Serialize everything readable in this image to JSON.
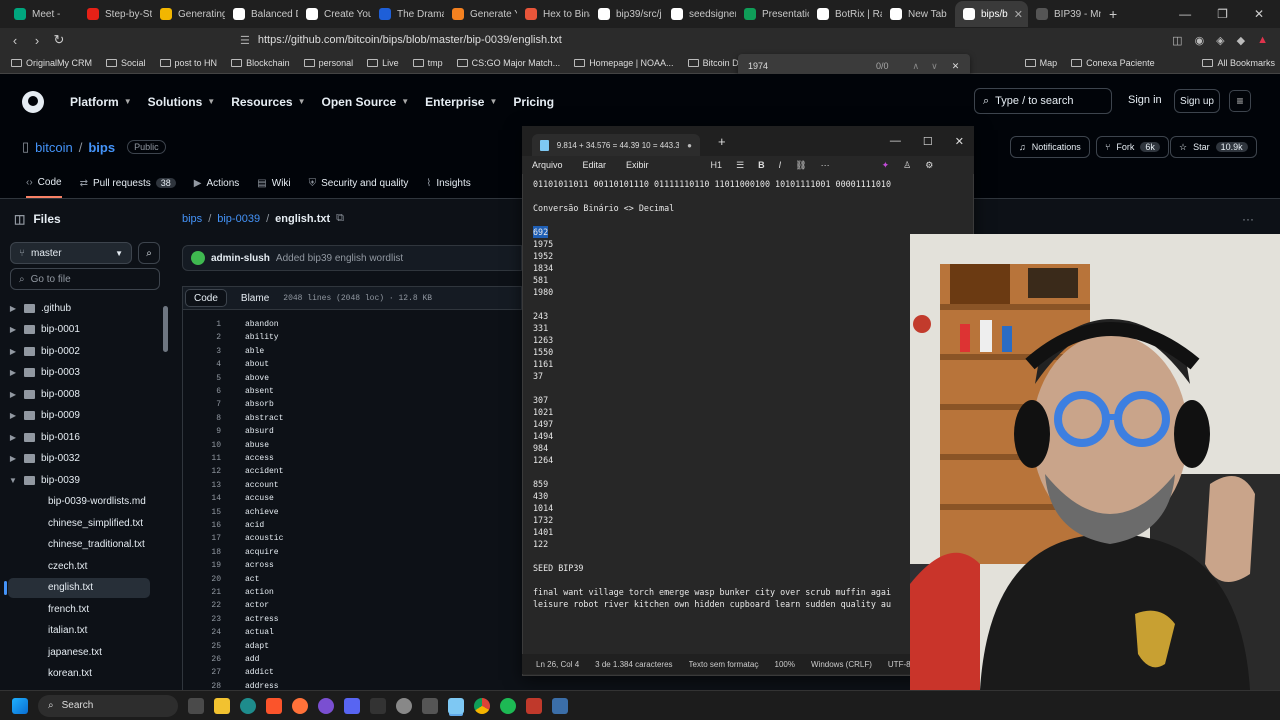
{
  "browser": {
    "tabs": [
      {
        "label": "Meet -",
        "color": "#00a67e"
      },
      {
        "label": "Step-by-St",
        "color": "#e62117"
      },
      {
        "label": "Generating",
        "color": "#f2b600"
      },
      {
        "label": "Balanced D",
        "color": "#ffffff"
      },
      {
        "label": "Create You",
        "color": "#ffffff"
      },
      {
        "label": "The Drama",
        "color": "#1e5fd8"
      },
      {
        "label": "Generate Y",
        "color": "#f48120"
      },
      {
        "label": "Hex to Bina",
        "color": "#e8553a"
      },
      {
        "label": "bip39/src/j",
        "color": "#ffffff"
      },
      {
        "label": "seedsigner",
        "color": "#ffffff"
      },
      {
        "label": "Presentatio",
        "color": "#0f9d58"
      },
      {
        "label": "BotRix | Ra",
        "color": "#ffffff"
      },
      {
        "label": "New Tab",
        "color": "#ffffff"
      },
      {
        "label": "bips/b",
        "color": "#ffffff",
        "active": true
      },
      {
        "label": "BIP39 - Mn",
        "color": "#555555"
      }
    ],
    "url": "https://github.com/bitcoin/bips/blob/master/bip-0039/english.txt",
    "bookmarks": [
      {
        "label": "OriginalMy CRM"
      },
      {
        "label": "Social"
      },
      {
        "label": "post to HN"
      },
      {
        "label": "Blockchain"
      },
      {
        "label": "personal"
      },
      {
        "label": "Live"
      },
      {
        "label": "tmp"
      },
      {
        "label": "CS:GO Major Match..."
      },
      {
        "label": "Homepage | NOAA..."
      },
      {
        "label": "Bitcoin Developmer"
      },
      {
        "label": "Map"
      },
      {
        "label": "Conexa Paciente"
      },
      {
        "label": "All Bookmarks"
      }
    ],
    "find": {
      "query": "1974",
      "count": "0/0"
    }
  },
  "github": {
    "nav": [
      "Platform",
      "Solutions",
      "Resources",
      "Open Source",
      "Enterprise",
      "Pricing"
    ],
    "search_label": "Type / to search",
    "sign_in": "Sign in",
    "sign_up": "Sign up",
    "owner": "bitcoin",
    "repo": "bips",
    "visibility": "Public",
    "repo_tabs": [
      {
        "label": "Code"
      },
      {
        "label": "Pull requests",
        "count": "38"
      },
      {
        "label": "Actions"
      },
      {
        "label": "Wiki"
      },
      {
        "label": "Security and quality"
      },
      {
        "label": "Insights"
      }
    ],
    "notifications": "Notifications",
    "fork": "Fork",
    "fork_count": "6k",
    "star": "Star",
    "star_count": "10.9k",
    "files_label": "Files",
    "branch": "master",
    "goto_placeholder": "Go to file",
    "tree": [
      {
        "label": ".github",
        "type": "folder"
      },
      {
        "label": "bip-0001",
        "type": "folder"
      },
      {
        "label": "bip-0002",
        "type": "folder"
      },
      {
        "label": "bip-0003",
        "type": "folder"
      },
      {
        "label": "bip-0008",
        "type": "folder"
      },
      {
        "label": "bip-0009",
        "type": "folder"
      },
      {
        "label": "bip-0016",
        "type": "folder"
      },
      {
        "label": "bip-0032",
        "type": "folder"
      },
      {
        "label": "bip-0039",
        "type": "folder-open"
      },
      {
        "label": "bip-0039-wordlists.md",
        "type": "file"
      },
      {
        "label": "chinese_simplified.txt",
        "type": "file"
      },
      {
        "label": "chinese_traditional.txt",
        "type": "file"
      },
      {
        "label": "czech.txt",
        "type": "file"
      },
      {
        "label": "english.txt",
        "type": "file",
        "selected": true
      },
      {
        "label": "french.txt",
        "type": "file"
      },
      {
        "label": "italian.txt",
        "type": "file"
      },
      {
        "label": "japanese.txt",
        "type": "file"
      },
      {
        "label": "korean.txt",
        "type": "file"
      }
    ],
    "breadcrumb": {
      "root": "bips",
      "dir": "bip-0039",
      "sep": "/",
      "file": "english.txt"
    },
    "commit": {
      "author": "admin-slush",
      "message": "Added bip39 english wordlist"
    },
    "code_tab": "Code",
    "blame_tab": "Blame",
    "file_info": "2048 lines (2048 loc) · 12.8 KB",
    "lines": [
      "abandon",
      "ability",
      "able",
      "about",
      "above",
      "absent",
      "absorb",
      "abstract",
      "absurd",
      "abuse",
      "access",
      "accident",
      "account",
      "accuse",
      "achieve",
      "acid",
      "acoustic",
      "acquire",
      "across",
      "act",
      "action",
      "actor",
      "actress",
      "actual",
      "adapt",
      "add",
      "addict",
      "address"
    ]
  },
  "notepad": {
    "tab_title": "9.814 + 34.576 = 44.39 10 = 443.39",
    "menu": [
      "Arquivo",
      "Editar",
      "Exibir"
    ],
    "heading": "H1",
    "lines": [
      "01101011011 00110101110 01111110110 11011000100 10101111001 00001111010",
      "",
      "Conversão Binário <> Decimal",
      "",
      "692",
      "1975",
      "1952",
      "1834",
      "581",
      "1980",
      "",
      "243",
      "331",
      "1263",
      "1550",
      "1161",
      "37",
      "",
      "307",
      "1021",
      "1497",
      "1494",
      "984",
      "1264",
      "",
      "859",
      "430",
      "1014",
      "1732",
      "1401",
      "122",
      "",
      "SEED BIP39",
      "",
      "final want village torch emerge wasp bunker city over scrub muffin agai",
      "leisure robot river kitchen own hidden cupboard learn sudden quality au"
    ],
    "status": {
      "position": "Ln 26, Col 4",
      "chars": "3 de 1.384 caracteres",
      "format": "Texto sem formatação",
      "zoom": "100%",
      "eol": "Windows (CRLF)",
      "encoding": "UTF-8"
    }
  },
  "taskbar": {
    "search": "Search"
  }
}
